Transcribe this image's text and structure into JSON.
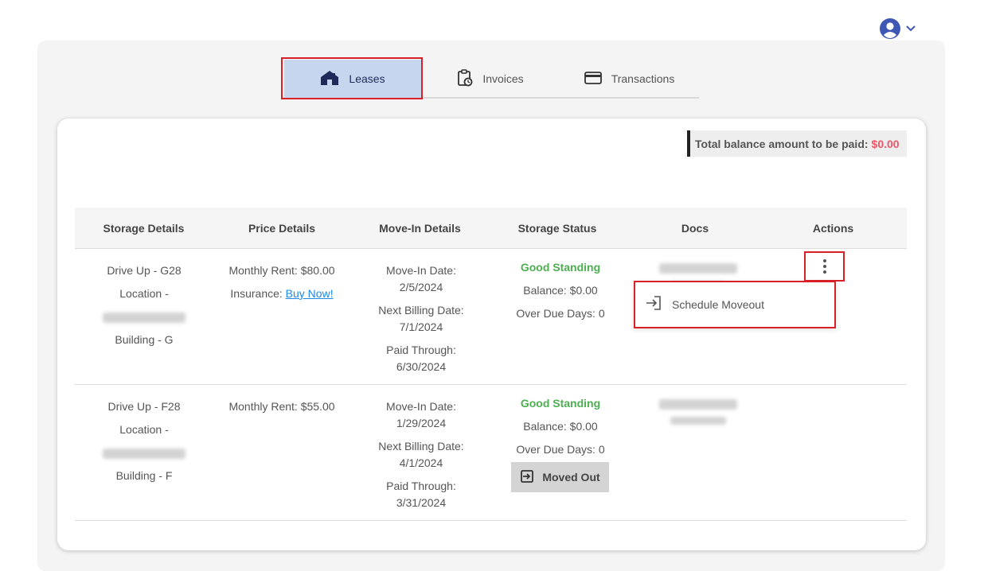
{
  "header": {
    "user_icon": "user-circle-icon",
    "chevron_icon": "chevron-down-icon"
  },
  "tabs": [
    {
      "label": "Leases",
      "icon": "home-icon",
      "active": true
    },
    {
      "label": "Invoices",
      "icon": "clipboard-clock-icon",
      "active": false
    },
    {
      "label": "Transactions",
      "icon": "credit-card-icon",
      "active": false
    }
  ],
  "balance": {
    "label": "Total balance amount to be paid:",
    "amount": "$0.00"
  },
  "table": {
    "headers": [
      "Storage Details",
      "Price Details",
      "Move-In Details",
      "Storage Status",
      "Docs",
      "Actions"
    ],
    "rows": [
      {
        "unit": "Drive Up - G28",
        "location_label": "Location -",
        "building": "Building - G",
        "monthly_rent": "Monthly Rent: $80.00",
        "insurance_label": "Insurance:",
        "insurance_link": "Buy Now!",
        "move_in_label": "Move-In Date:",
        "move_in_date": "2/5/2024",
        "next_billing_label": "Next Billing Date:",
        "next_billing_date": "7/1/2024",
        "paid_through_label": "Paid Through:",
        "paid_through_date": "6/30/2024",
        "status": "Good Standing",
        "balance": "Balance: $0.00",
        "overdue": "Over Due Days: 0"
      },
      {
        "unit": "Drive Up - F28",
        "location_label": "Location -",
        "building": "Building - F",
        "monthly_rent": "Monthly Rent: $55.00",
        "move_in_label": "Move-In Date:",
        "move_in_date": "1/29/2024",
        "next_billing_label": "Next Billing Date:",
        "next_billing_date": "4/1/2024",
        "paid_through_label": "Paid Through:",
        "paid_through_date": "3/31/2024",
        "status": "Good Standing",
        "balance": "Balance: $0.00",
        "overdue": "Over Due Days: 0",
        "moved_out_label": "Moved Out"
      }
    ]
  },
  "actions_menu": {
    "items": [
      {
        "label": "Schedule Moveout",
        "icon": "sign-in-arrow-icon"
      }
    ]
  },
  "colors": {
    "active_tab_bg": "#c6d6ee",
    "highlight_border": "#d92027",
    "good_standing": "#4caf50",
    "balance_amount": "#ef5667",
    "link": "#1e88e5",
    "brand_navy": "#1f2a5a"
  }
}
